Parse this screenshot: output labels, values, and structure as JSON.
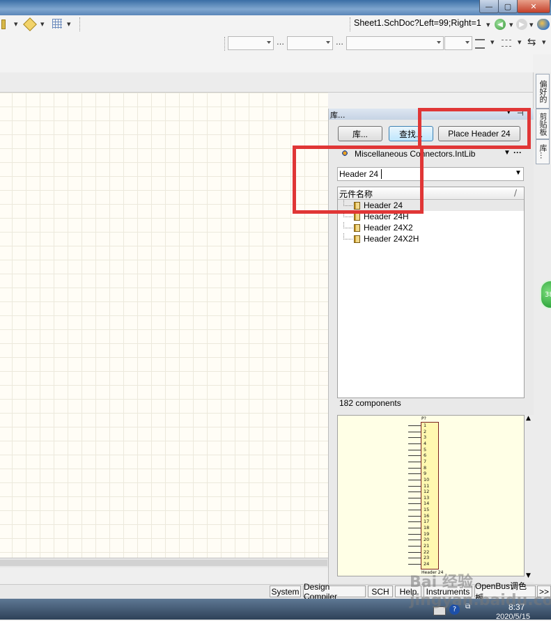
{
  "window": {
    "address": "Sheet1.SchDoc?Left=99;Right=1",
    "btn_min": "—",
    "btn_max": "▢",
    "btn_close": "✕"
  },
  "vertical_tabs": [
    "偏好的",
    "剪贴板",
    "库..."
  ],
  "bubble_text": "38",
  "library_panel": {
    "title": "库...",
    "btn_libraries": "库...",
    "btn_search": "查找...",
    "btn_place": "Place Header 24",
    "selected_library": "Miscellaneous Connectors.IntLib",
    "more": "···",
    "filter_value": "Header 24",
    "column_header": "元件名称",
    "sort_mark": "/",
    "components": [
      "Header 24",
      "Header 24H",
      "Header 24X2",
      "Header 24X2H"
    ],
    "count": "182 components",
    "preview": {
      "designator": "P?",
      "part_name": "Header 24",
      "pins": [
        "1",
        "2",
        "3",
        "4",
        "5",
        "6",
        "7",
        "8",
        "9",
        "10",
        "11",
        "12",
        "13",
        "14",
        "15",
        "16",
        "17",
        "18",
        "19",
        "20",
        "21",
        "22",
        "23",
        "24"
      ]
    }
  },
  "status_tabs": [
    "System",
    "Design Compiler",
    "SCH",
    "Help",
    "Instruments",
    "OpenBus调色板"
  ],
  "status_more": ">>",
  "clock": {
    "time": "8:37",
    "date": "2020/5/15"
  },
  "watermark": "Bai 经验 jingyan.baidu.com",
  "colors": {
    "highlight": "#e03636",
    "preview_bg": "#ffffe6",
    "sheet_bg": "#fffdf6"
  }
}
